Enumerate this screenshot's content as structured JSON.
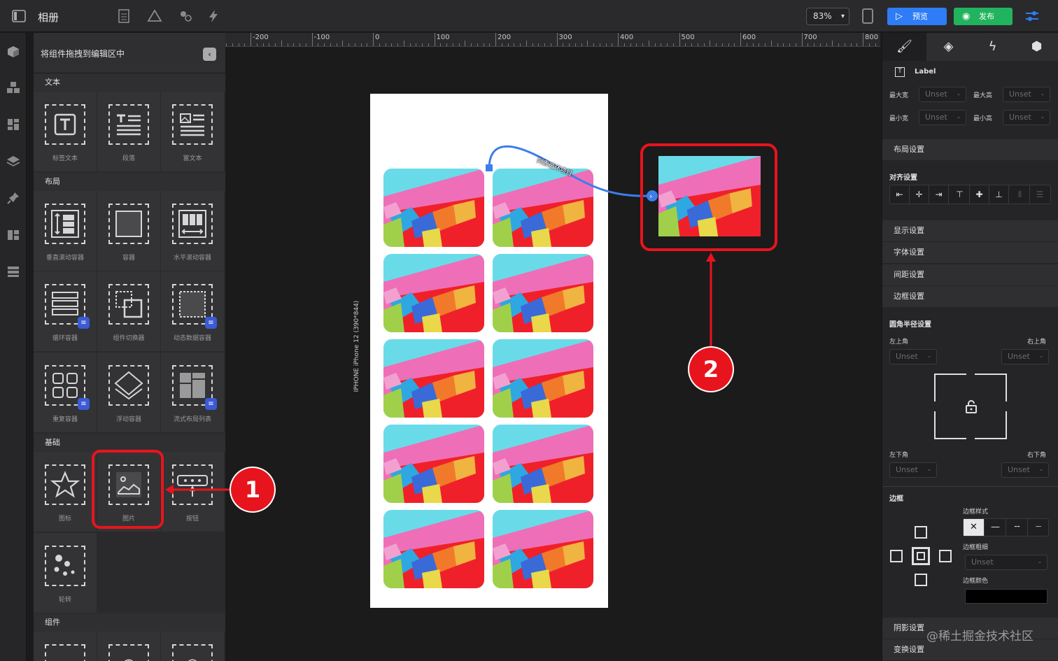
{
  "topbar": {
    "title": "相册",
    "zoom": "83%",
    "preview_label": "预览",
    "publish_label": "发布"
  },
  "left_panel": {
    "header": "将组件拖拽到编辑区中",
    "sections": {
      "text": "文本",
      "layout": "布局",
      "basic": "基础",
      "components": "组件"
    },
    "tiles": {
      "label_text": "标签文本",
      "paragraph": "段落",
      "rich_text": "富文本",
      "vertical_scroll": "垂直滚动容器",
      "container": "容器",
      "horizontal_scroll": "水平滚动容器",
      "loop_container": "循环容器",
      "component_switcher": "组件切换器",
      "dynamic_data": "动态数据容器",
      "repeat_container": "重复容器",
      "float_container": "浮动容器",
      "flow_layout": "流式布局列表",
      "icon": "图标",
      "image": "图片",
      "button": "按钮",
      "carousel": "轮转"
    }
  },
  "ruler": {
    "labels": [
      "-200",
      "-100",
      "0",
      "100",
      "200",
      "300",
      "400",
      "500",
      "600",
      "700",
      "800"
    ]
  },
  "canvas": {
    "device_label": "IPHONE   iPhone 12 (390*844)",
    "curve_label": "列表循环项目",
    "callout_1": "1",
    "callout_2": "2"
  },
  "right_panel": {
    "component_name": "Label",
    "max_width": "最大宽",
    "max_height": "最大高",
    "min_width": "最小宽",
    "min_height": "最小高",
    "unset": "Unset",
    "dash": "-",
    "layout_settings": "布局设置",
    "align_settings": "对齐设置",
    "display_settings": "显示设置",
    "font_settings": "字体设置",
    "spacing_settings": "间距设置",
    "border_settings": "边框设置",
    "radius_settings": "圆角半径设置",
    "top_left": "左上角",
    "top_right": "右上角",
    "bottom_left": "左下角",
    "bottom_right": "右下角",
    "border": "边框",
    "border_style": "边框样式",
    "border_width": "边框粗细",
    "border_color": "边框颜色",
    "shadow_settings": "阴影设置",
    "transform_settings": "变换设置"
  },
  "watermark": "@稀土掘金技术社区",
  "colors": {
    "accent_blue": "#2e7cf6",
    "publish_green": "#22b35e",
    "callout_red": "#e8141d"
  }
}
